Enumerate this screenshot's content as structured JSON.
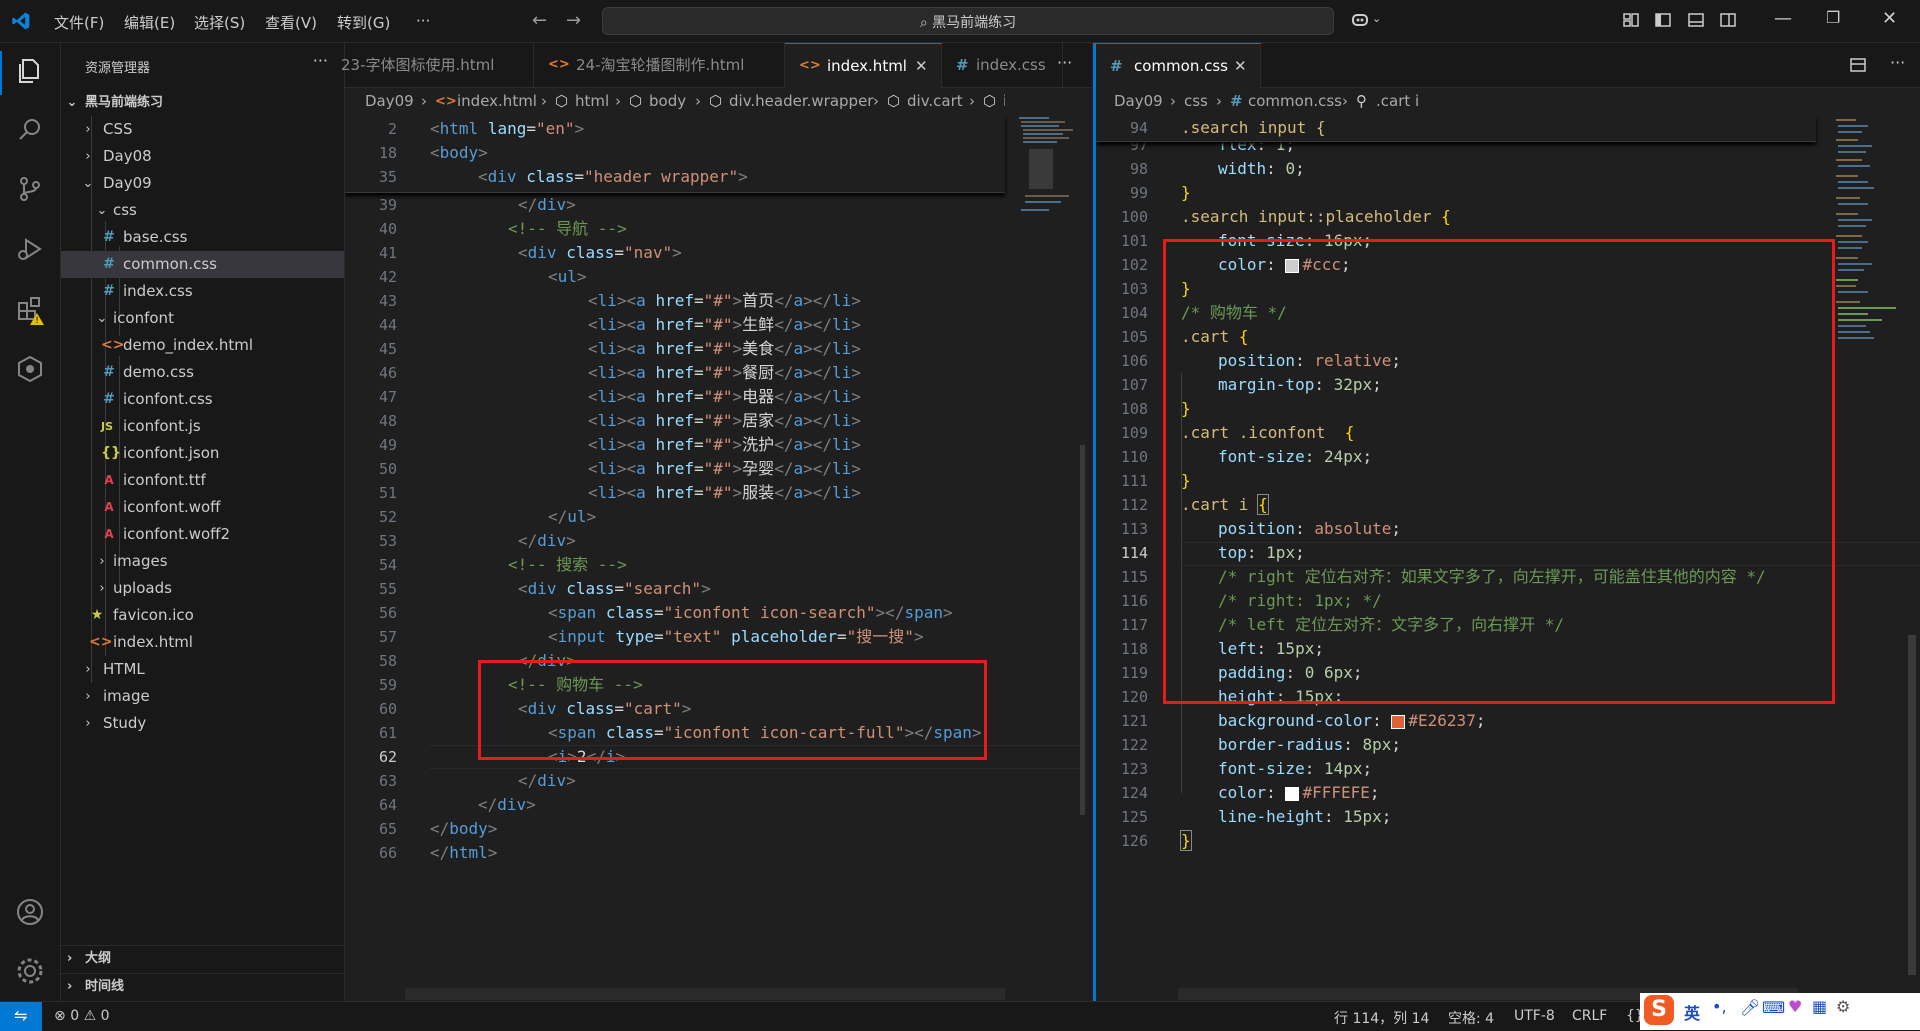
{
  "titlebar": {
    "menus": [
      "文件(F)",
      "编辑(E)",
      "选择(S)",
      "查看(V)",
      "转到(G)",
      "···"
    ],
    "search_text": "黑马前端练习"
  },
  "explorer": {
    "title": "资源管理器",
    "more": "···",
    "root": "黑马前端练习",
    "items": [
      {
        "label": "CSS",
        "kind": "folder",
        "open": false
      },
      {
        "label": "Day08",
        "kind": "folder",
        "open": false
      },
      {
        "label": "Day09",
        "kind": "folder",
        "open": true
      },
      {
        "label": "css",
        "kind": "folder",
        "open": true
      },
      {
        "label": "base.css",
        "kind": "css"
      },
      {
        "label": "common.css",
        "kind": "css"
      },
      {
        "label": "index.css",
        "kind": "css"
      },
      {
        "label": "iconfont",
        "kind": "folder",
        "open": true
      },
      {
        "label": "demo_index.html",
        "kind": "html"
      },
      {
        "label": "demo.css",
        "kind": "css"
      },
      {
        "label": "iconfont.css",
        "kind": "css"
      },
      {
        "label": "iconfont.js",
        "kind": "js"
      },
      {
        "label": "iconfont.json",
        "kind": "json"
      },
      {
        "label": "iconfont.ttf",
        "kind": "font"
      },
      {
        "label": "iconfont.woff",
        "kind": "font"
      },
      {
        "label": "iconfont.woff2",
        "kind": "font"
      },
      {
        "label": "images",
        "kind": "folder",
        "open": false
      },
      {
        "label": "uploads",
        "kind": "folder",
        "open": false
      },
      {
        "label": "favicon.ico",
        "kind": "ico"
      },
      {
        "label": "index.html",
        "kind": "html"
      },
      {
        "label": "HTML",
        "kind": "folder",
        "open": false
      },
      {
        "label": "image",
        "kind": "folder",
        "open": false
      },
      {
        "label": "Study",
        "kind": "folder",
        "open": false
      }
    ],
    "outline": "大纲",
    "timeline": "时间线"
  },
  "left_editor": {
    "tabs": [
      {
        "label": "23-字体图标使用.html",
        "icon": "<>"
      },
      {
        "label": "24-淘宝轮播图制作.html",
        "icon": "<>"
      },
      {
        "label": "index.html",
        "icon": "<>"
      },
      {
        "label": "index.css",
        "icon": "#"
      }
    ],
    "tabs_more": "···",
    "breadcrumbs": [
      "Day09",
      "index.html",
      "html",
      "body",
      "div.header.wrapper",
      "div.cart",
      "i"
    ],
    "sticky_nums": [
      "2",
      "18",
      "35"
    ],
    "line_nums": [
      "39",
      "40",
      "41",
      "42",
      "43",
      "44",
      "45",
      "46",
      "47",
      "48",
      "49",
      "50",
      "51",
      "52",
      "53",
      "54",
      "55",
      "56",
      "57",
      "58",
      "59",
      "60",
      "61",
      "62",
      "63",
      "64",
      "65",
      "66"
    ],
    "current_line": "62",
    "code_text": {
      "lang_attr": "lang",
      "lang_val": "\"en\"",
      "class_attr": "class",
      "header_val": "\"header wrapper\"",
      "nav_comment": "<!-- 导航 -->",
      "nav_val": "\"nav\"",
      "href_attr": "href",
      "hash_val": "\"#\"",
      "nav_items": [
        "首页",
        "生鲜",
        "美食",
        "餐厨",
        "电器",
        "居家",
        "洗护",
        "孕婴",
        "服装"
      ],
      "search_comment": "<!-- 搜索 -->",
      "search_val": "\"search\"",
      "icon_search_val": "\"iconfont icon-search\"",
      "type_attr": "type",
      "text_val": "\"text\"",
      "placeholder_attr": "placeholder",
      "placeholder_val": "\"搜一搜\"",
      "cart_comment": "<!-- 购物车 -->",
      "cart_val": "\"cart\"",
      "icon_cart_val": "\"iconfont icon-cart-full\"",
      "i_text": "2"
    }
  },
  "right_editor": {
    "tab": {
      "label": "common.css",
      "icon": "#"
    },
    "breadcrumbs": [
      "Day09",
      "css",
      "common.css",
      ".cart i"
    ],
    "sticky_num": "94",
    "sticky_text": ".search input {",
    "line_nums": [
      "97",
      "98",
      "99",
      "100",
      "101",
      "102",
      "103",
      "104",
      "105",
      "106",
      "107",
      "108",
      "109",
      "110",
      "111",
      "112",
      "113",
      "114",
      "115",
      "116",
      "117",
      "118",
      "119",
      "120",
      "121",
      "122",
      "123",
      "124",
      "125",
      "126"
    ],
    "current_line": "114",
    "code_text": {
      "flex": "flex",
      "flex_val": "1",
      "width": "width",
      "width_val": "0",
      "placeholder_sel": ".search input::placeholder",
      "font_size": "font-size",
      "fs16": "16px",
      "color": "color",
      "ccc": "#ccc",
      "cart_comment": "/* 购物车 */",
      "cart_sel": ".cart",
      "position": "position",
      "relative": "relative",
      "margin_top": "margin-top",
      "mt32": "32px",
      "cart_iconfont_sel": ".cart .iconfont",
      "fs24": "24px",
      "cart_i_sel": ".cart i",
      "absolute": "absolute",
      "top": "top",
      "top1": "1px",
      "c1": "/* right 定位右对齐：如果文字多了，向左撑开，可能盖住其他的内容 */",
      "c2": "/* right: 1px; */",
      "c3": "/* left 定位左对齐：文字多了，向右撑开 */",
      "left": "left",
      "left15": "15px",
      "padding": "padding",
      "pad_val": "0 6px",
      "height": "height",
      "h15": "15px",
      "bg": "background-color",
      "bg_val": "#E26237",
      "radius": "border-radius",
      "r8": "8px",
      "fs14": "14px",
      "fffefe": "#FFFEFE",
      "lh": "line-height",
      "lh15": "15px"
    }
  },
  "colors": {
    "swatch_ccc": "#cccccc",
    "swatch_bg": "#E26237",
    "swatch_white": "#FFFEFE",
    "accent": "#0078d4",
    "highlight_box": "#e81b1b"
  },
  "statusbar": {
    "errors": "0",
    "warnings": "0",
    "position": "行 114，列 14",
    "spaces": "空格: 4",
    "encoding": "UTF-8",
    "eol": "CRLF",
    "braces": "{}",
    "ime_lang": "英"
  }
}
